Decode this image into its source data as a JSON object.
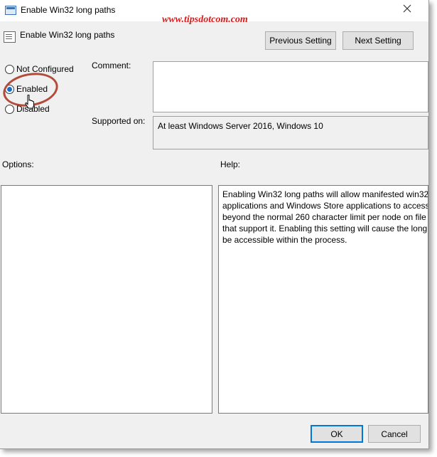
{
  "window": {
    "title": "Enable Win32 long paths",
    "watermark": "www.tipsdotcom.com"
  },
  "header": {
    "title": "Enable Win32 long paths",
    "previous_label": "Previous Setting",
    "next_label": "Next Setting"
  },
  "state": {
    "options": [
      {
        "label": "Not Configured",
        "checked": false
      },
      {
        "label": "Enabled",
        "checked": true
      },
      {
        "label": "Disabled",
        "checked": false
      }
    ]
  },
  "comment": {
    "label": "Comment:",
    "value": ""
  },
  "supported": {
    "label": "Supported on:",
    "value": "At least Windows Server 2016, Windows 10"
  },
  "options_section": {
    "label": "Options:"
  },
  "help_section": {
    "label": "Help:",
    "lines": [
      "Enabling Win32 long paths will allow manifested win32",
      "applications and Windows Store applications to access",
      "beyond the normal 260 character limit per node on file",
      "that support it.  Enabling this setting will cause the long",
      "be accessible within the process."
    ]
  },
  "footer": {
    "ok_label": "OK",
    "cancel_label": "Cancel"
  },
  "colors": {
    "annotation": "#b34a3a",
    "watermark": "#d91a1a",
    "accent": "#0078d7"
  }
}
